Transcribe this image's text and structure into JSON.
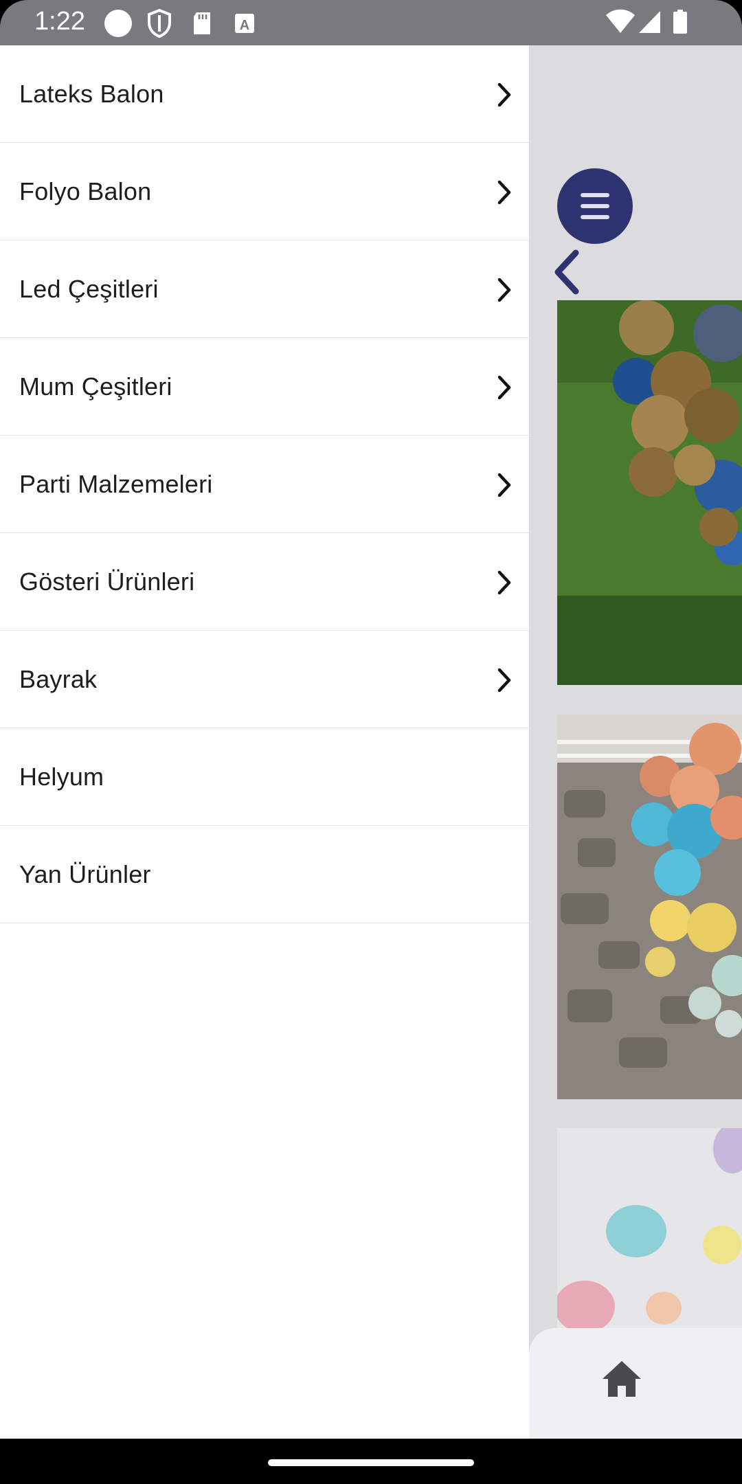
{
  "status_bar": {
    "time": "1:22",
    "icons_left": [
      "circle-icon",
      "shield-icon",
      "sd-card-icon",
      "font-a-icon"
    ],
    "icons_right": [
      "wifi-icon",
      "signal-icon",
      "battery-icon"
    ]
  },
  "drawer": {
    "items": [
      {
        "label": "Lateks Balon",
        "has_submenu": true
      },
      {
        "label": "Folyo Balon",
        "has_submenu": true
      },
      {
        "label": "Led Çeşitleri",
        "has_submenu": true
      },
      {
        "label": "Mum Çeşitleri",
        "has_submenu": true
      },
      {
        "label": "Parti Malzemeleri",
        "has_submenu": true
      },
      {
        "label": "Gösteri Ürünleri",
        "has_submenu": true
      },
      {
        "label": "Bayrak",
        "has_submenu": true
      },
      {
        "label": "Helyum",
        "has_submenu": false
      },
      {
        "label": "Yan Ürünler",
        "has_submenu": false
      }
    ]
  },
  "app": {
    "menu_button_icon": "hamburger-icon",
    "back_icon": "chevron-left-icon",
    "photos": [
      "gold-blue-balloons-photo",
      "pastel-balloon-garland-photo",
      "pastel-balloons-photo"
    ],
    "bottom_nav": {
      "icon": "home-icon"
    }
  },
  "colors": {
    "accent": "#2e3470",
    "drawer_bg": "#ffffff",
    "scrim": "#dcdbde",
    "status_bar": "#7a797d"
  }
}
